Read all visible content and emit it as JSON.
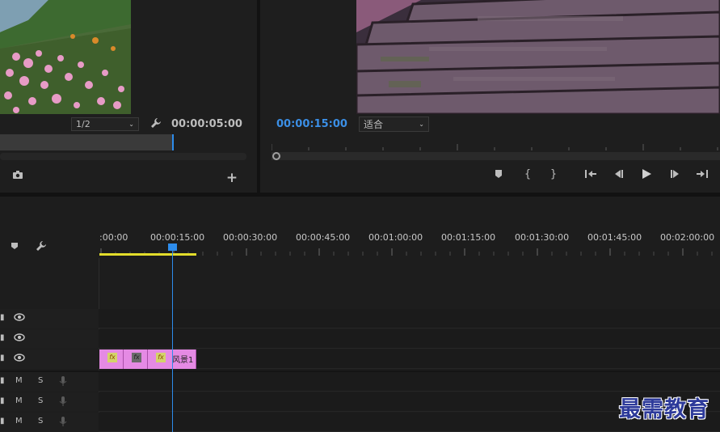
{
  "source_monitor": {
    "resolution": "1/2",
    "timecode": "00:00:05:00"
  },
  "program_monitor": {
    "timecode": "00:00:15:00",
    "fit": "适合"
  },
  "timeline": {
    "ruler": [
      ":00:00",
      "00:00:15:00",
      "00:00:30:00",
      "00:00:45:00",
      "00:01:00:00",
      "00:01:15:00",
      "00:01:30:00",
      "00:01:45:00",
      "00:02:00:00"
    ],
    "clip_label": "风景1",
    "audio_m": "M",
    "audio_s": "S"
  },
  "watermark": "最需教育",
  "colors": {
    "timecode_blue": "#3b8fe6",
    "playhead": "#2d8ceb",
    "clip": "#e58ae4",
    "work_area": "#e3dd2b"
  },
  "icons": [
    "wrench-icon",
    "camera-icon",
    "plus-icon",
    "marker-icon",
    "mark-in-icon",
    "mark-out-icon",
    "go-to-in-icon",
    "step-back-icon",
    "play-icon",
    "step-forward-icon",
    "go-to-out-icon",
    "eye-icon",
    "mic-icon",
    "fx-icon"
  ]
}
